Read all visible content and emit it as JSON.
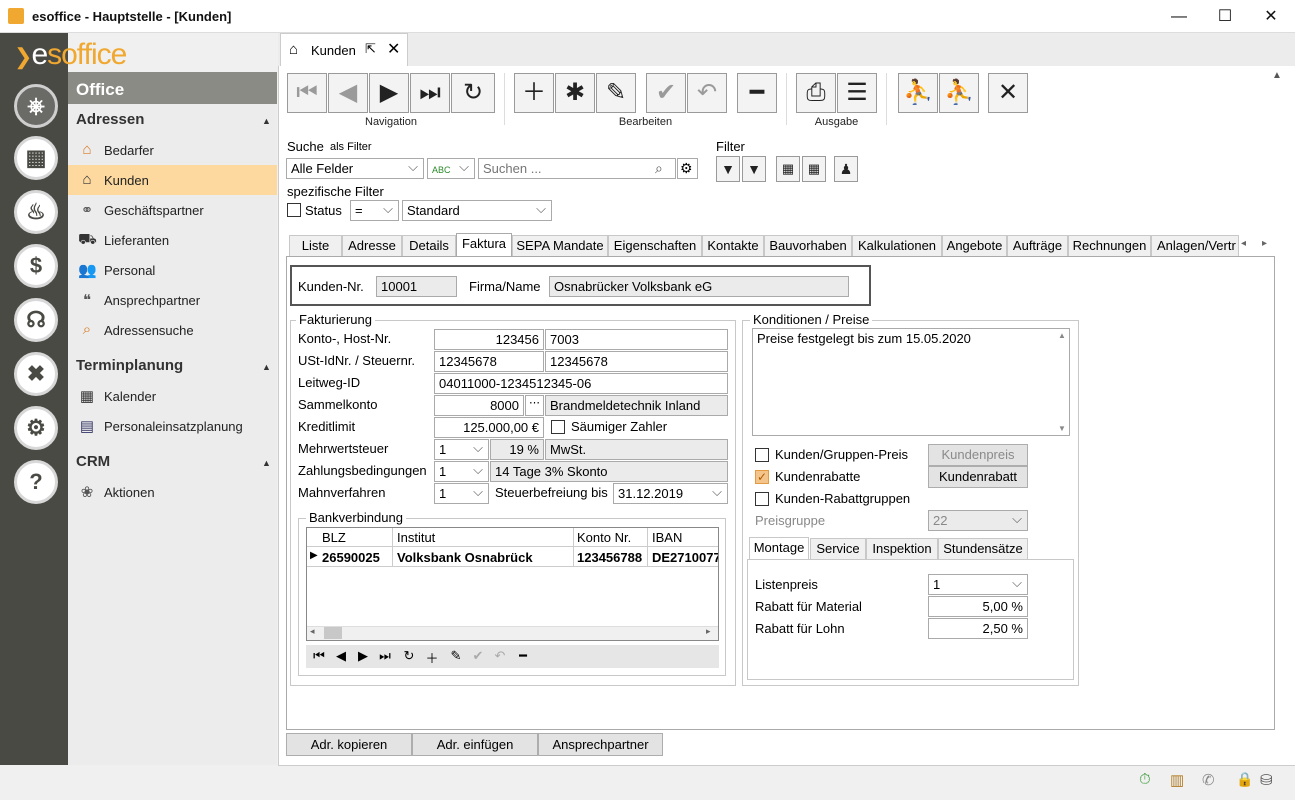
{
  "window": {
    "title": "esoffice - Hauptstelle - [Kunden]"
  },
  "logo": {
    "text_pre": "e",
    "text": "soffice"
  },
  "sidebar": {
    "header": "Office",
    "sections": [
      {
        "title": "Adressen",
        "items": [
          "Bedarfer",
          "Kunden",
          "Geschäftspartner",
          "Lieferanten",
          "Personal",
          "Ansprechpartner",
          "Adressensuche"
        ]
      },
      {
        "title": "Terminplanung",
        "items": [
          "Kalender",
          "Personaleinsatzplanung"
        ]
      },
      {
        "title": "CRM",
        "items": [
          "Aktionen"
        ]
      }
    ]
  },
  "doc_tab": {
    "label": "Kunden"
  },
  "toolbar": {
    "group_navigation": "Navigation",
    "group_bearbeiten": "Bearbeiten",
    "group_ausgabe": "Ausgabe"
  },
  "search": {
    "label": "Suche",
    "as_filter": "als Filter",
    "field_value": "Alle Felder",
    "placeholder": "Suchen ...",
    "filter_label": "Filter",
    "specific_label": "spezifische Filter",
    "status_label": "Status",
    "operator": "=",
    "standard": "Standard"
  },
  "page_tabs": [
    "Liste",
    "Adresse",
    "Details",
    "Faktura",
    "SEPA Mandate",
    "Eigenschaften",
    "Kontakte",
    "Bauvorhaben",
    "Kalkulationen",
    "Angebote",
    "Aufträge",
    "Rechnungen",
    "Anlagen/Vertr"
  ],
  "header_fields": {
    "kunden_nr_label": "Kunden-Nr.",
    "kunden_nr": "10001",
    "firma_label": "Firma/Name",
    "firma": "Osnabrücker Volksbank eG"
  },
  "fakturierung": {
    "title": "Fakturierung",
    "konto_label": "Konto-, Host-Nr.",
    "konto": "123456",
    "host": "7003",
    "ust_label": "USt-IdNr. / Steuernr.",
    "ust": "12345678",
    "steuer": "12345678",
    "leitweg_label": "Leitweg-ID",
    "leitweg": "04011000-1234512345-06",
    "sammel_label": "Sammelkonto",
    "sammel": "8000",
    "sammel_name": "Brandmeldetechnik Inland",
    "kredit_label": "Kreditlimit",
    "kredit": "125.000,00 €",
    "saeumig": "Säumiger Zahler",
    "mwst_label": "Mehrwertsteuer",
    "mwst": "1",
    "mwst_pct": "19 %",
    "mwst_name": "MwSt.",
    "zahl_label": "Zahlungsbedingungen",
    "zahl": "1",
    "zahl_name": "14 Tage 3% Skonto",
    "mahn_label": "Mahnverfahren",
    "mahn": "1",
    "steuerbefreiung_label": "Steuerbefreiung bis",
    "steuerbefreiung": "31.12.2019"
  },
  "bank": {
    "title": "Bankverbindung",
    "columns": [
      "BLZ",
      "Institut",
      "Konto Nr.",
      "IBAN"
    ],
    "rows": [
      [
        "26590025",
        "Volksbank Osnabrück",
        "123456788",
        "DE2710077"
      ]
    ]
  },
  "konditionen": {
    "title": "Konditionen / Preise",
    "note": "Preise festgelegt bis zum 15.05.2020",
    "gruppenpreis": "Kunden/Gruppen-Preis",
    "btn_kundenpreis": "Kundenpreis",
    "kundenrabatte": "Kundenrabatte",
    "btn_kundenrabatt": "Kundenrabatt",
    "rabattgruppen": "Kunden-Rabattgruppen",
    "preisgruppe_label": "Preisgruppe",
    "preisgruppe": "22",
    "tabs": [
      "Montage",
      "Service",
      "Inspektion",
      "Stundensätze"
    ],
    "listenpreis_label": "Listenpreis",
    "listenpreis": "1",
    "rabatt_material_label": "Rabatt für Material",
    "rabatt_material": "5,00 %",
    "rabatt_lohn_label": "Rabatt für Lohn",
    "rabatt_lohn": "2,50 %"
  },
  "bottom_buttons": [
    "Adr. kopieren",
    "Adr. einfügen",
    "Ansprechpartner"
  ],
  "colors": {
    "sidebar_dark": "#4a4a45",
    "selected": "#fdd9a0",
    "accent": "#f0a830"
  }
}
